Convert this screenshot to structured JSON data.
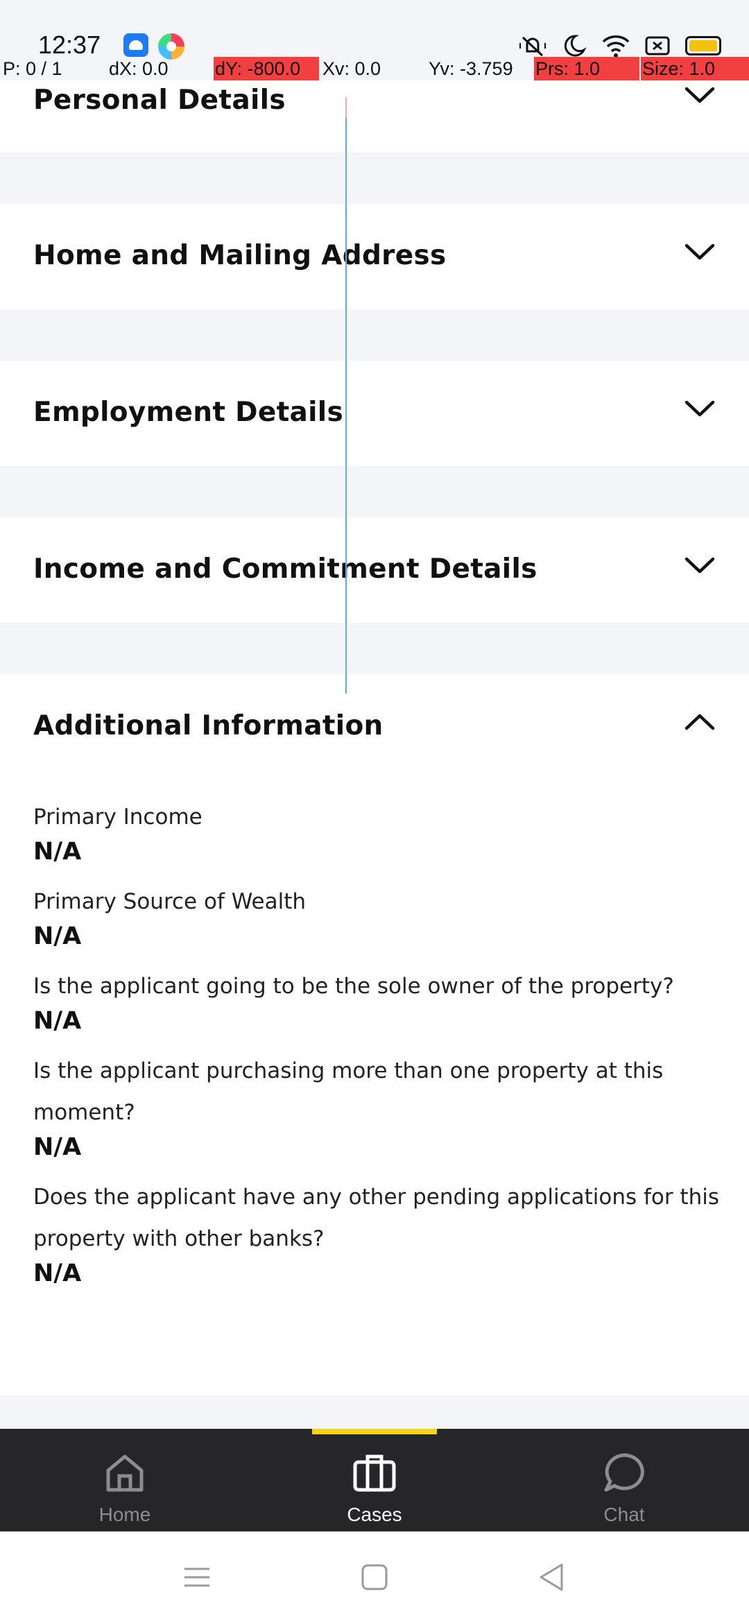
{
  "status_bar": {
    "time": "12:37",
    "icons": [
      "android-app-icon",
      "browser-app-icon",
      "mute-icon",
      "moon-icon",
      "wifi-icon",
      "screen-record-icon",
      "battery-icon"
    ]
  },
  "debug_overlay": {
    "p": "P: 0 / 1",
    "dx": "dX: 0.0",
    "dy": "dY: -800.0",
    "xv": "Xv: 0.0",
    "yv": "Yv: -3.759",
    "prs": "Prs: 1.0",
    "size": "Size: 1.0",
    "highlight_color": "#f23f3f"
  },
  "sections": [
    {
      "title": "Personal Details",
      "expanded": false
    },
    {
      "title": "Home and Mailing Address",
      "expanded": false
    },
    {
      "title": "Employment Details",
      "expanded": false
    },
    {
      "title": "Income and Commitment Details",
      "expanded": false
    },
    {
      "title": "Additional Information",
      "expanded": true
    }
  ],
  "additional_information": {
    "fields": [
      {
        "label": "Primary Income",
        "value": "N/A"
      },
      {
        "label": "Primary Source of Wealth",
        "value": "N/A"
      },
      {
        "label": "Is the applicant going to be the sole owner of the property?",
        "value": "N/A"
      },
      {
        "label": "Is the applicant purchasing more than one property at this moment?",
        "value": "N/A"
      },
      {
        "label": "Does the applicant have any other pending applications for this property with other banks?",
        "value": "N/A"
      }
    ]
  },
  "bottom_nav": {
    "items": [
      {
        "label": "Home",
        "icon": "home-icon",
        "active": false
      },
      {
        "label": "Cases",
        "icon": "briefcase-icon",
        "active": true
      },
      {
        "label": "Chat",
        "icon": "chat-bubble-icon",
        "active": false
      }
    ],
    "active_color": "#ffffff",
    "inactive_color": "#8d8d90",
    "indicator_color": "#f5d31d"
  },
  "system_nav": {
    "buttons": [
      "menu-icon",
      "home-square-icon",
      "back-triangle-icon"
    ]
  }
}
